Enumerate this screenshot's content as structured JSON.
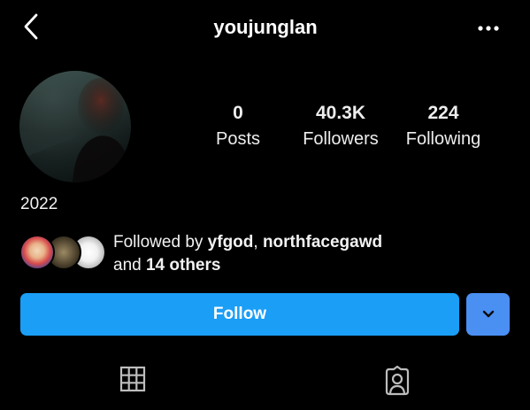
{
  "header": {
    "username": "youjunglan",
    "back_icon": "chevron-left-icon",
    "more_icon": "more-horizontal-icon"
  },
  "profile": {
    "avatar_icon": "profile-photo",
    "stats": {
      "posts": {
        "value": "0",
        "label": "Posts"
      },
      "followers": {
        "value": "40.3K",
        "label": "Followers"
      },
      "following": {
        "value": "224",
        "label": "Following"
      }
    },
    "bio": "2022"
  },
  "followed_by": {
    "prefix": "Followed by ",
    "user1": "yfgod",
    "separator": ", ",
    "user2": "northfacegawd",
    "line2_prefix": "and ",
    "others": "14 others"
  },
  "actions": {
    "follow_label": "Follow",
    "follow_color": "#1a9ef6",
    "dropdown_icon": "chevron-down-icon",
    "dropdown_color": "#4a8ff2"
  },
  "tabs": {
    "grid_icon": "grid-icon",
    "tagged_icon": "tagged-person-icon"
  }
}
